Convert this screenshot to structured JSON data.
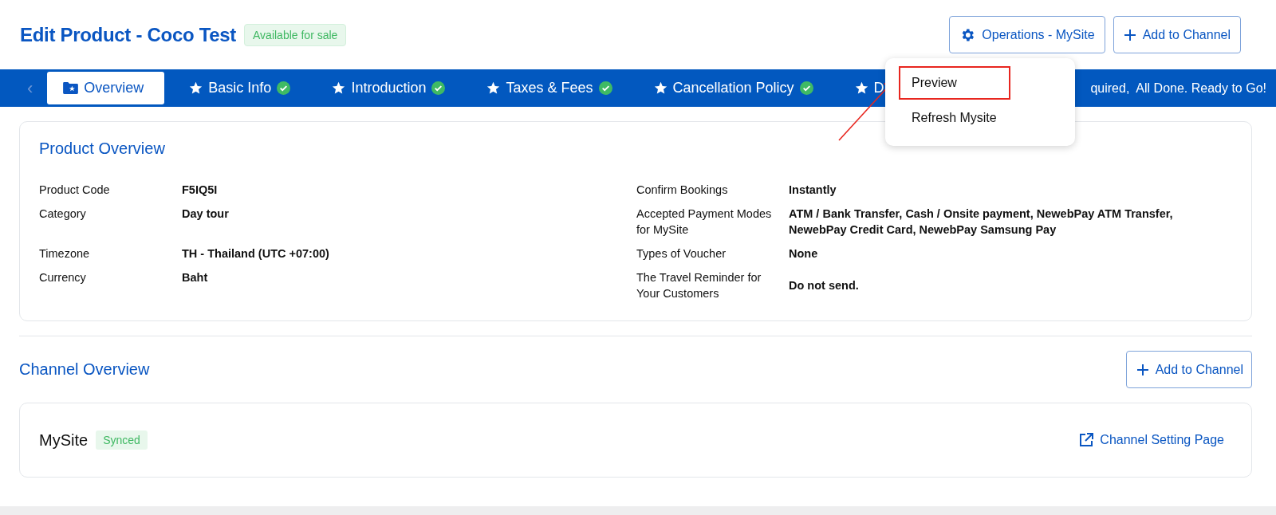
{
  "header": {
    "title": "Edit Product - Coco Test",
    "status_badge": "Available for sale",
    "buttons": [
      {
        "label": "Operations - MySite",
        "kind": "operations"
      },
      {
        "label": "Add to Channel",
        "kind": "add"
      }
    ]
  },
  "tab_bar": {
    "scroll_left": "‹",
    "tabs": [
      {
        "label": "Overview",
        "kind": "overview",
        "selected": true,
        "done": false
      },
      {
        "label": "Basic Info",
        "kind": "step",
        "selected": false,
        "done": true
      },
      {
        "label": "Introduction",
        "kind": "step",
        "selected": false,
        "done": true
      },
      {
        "label": "Taxes & Fees",
        "kind": "step",
        "selected": false,
        "done": true
      },
      {
        "label": "Cancellation Policy",
        "kind": "step",
        "selected": false,
        "done": true
      },
      {
        "label": "D",
        "kind": "step",
        "selected": false,
        "done": false
      }
    ],
    "status_text": "quired,  All Done. Ready to Go!"
  },
  "dropdown": {
    "items": [
      {
        "label": "Preview",
        "highlighted": true
      },
      {
        "label": "Refresh Mysite",
        "highlighted": false
      }
    ]
  },
  "product_overview": {
    "title": "Product Overview",
    "fields": [
      {
        "label": "Product Code",
        "value": "F5IQ5I"
      },
      {
        "label": "Confirm Bookings",
        "value": "Instantly"
      },
      {
        "label": "Category",
        "value": "Day tour"
      },
      {
        "label": "Accepted Payment Modes for MySite",
        "value": "ATM / Bank Transfer, Cash / Onsite payment, NewebPay ATM Transfer, NewebPay Credit Card, NewebPay Samsung Pay"
      },
      {
        "label": "Timezone",
        "value": "TH - Thailand (UTC +07:00)"
      },
      {
        "label": "Types of Voucher",
        "value": "None"
      },
      {
        "label": "Currency",
        "value": "Baht"
      },
      {
        "label": "The Travel Reminder for Your Customers",
        "value": "Do not send."
      }
    ]
  },
  "channel_overview": {
    "title": "Channel Overview",
    "add_button": "Add to Channel",
    "channels": [
      {
        "name": "MySite",
        "status": "Synced",
        "link": "Channel Setting Page"
      }
    ]
  }
}
